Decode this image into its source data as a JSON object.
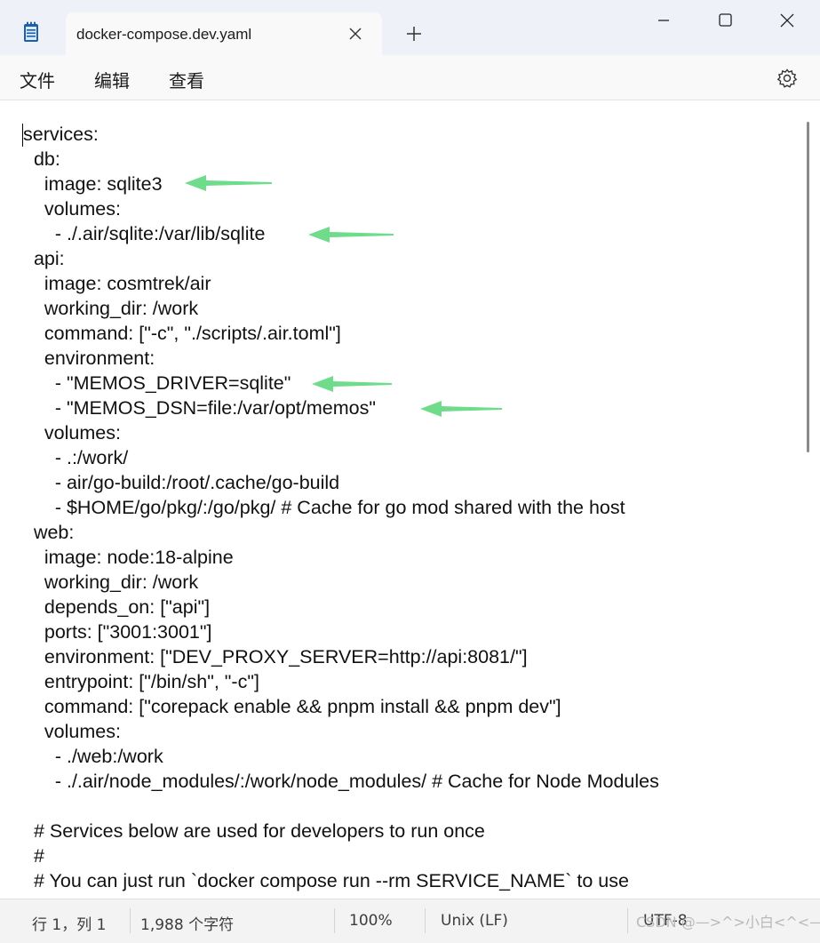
{
  "tab": {
    "title": "docker-compose.dev.yaml"
  },
  "menu": {
    "items": [
      "文件",
      "编辑",
      "查看"
    ]
  },
  "editor": {
    "lines": [
      "services:",
      "  db:",
      "    image: sqlite3",
      "    volumes:",
      "      - ./.air/sqlite:/var/lib/sqlite",
      "  api:",
      "    image: cosmtrek/air",
      "    working_dir: /work",
      "    command: [\"-c\", \"./scripts/.air.toml\"]",
      "    environment:",
      "      - \"MEMOS_DRIVER=sqlite\"",
      "      - \"MEMOS_DSN=file:/var/opt/memos\"",
      "    volumes:",
      "      - .:/work/",
      "      - air/go-build:/root/.cache/go-build",
      "      - $HOME/go/pkg/:/go/pkg/ # Cache for go mod shared with the host",
      "  web:",
      "    image: node:18-alpine",
      "    working_dir: /work",
      "    depends_on: [\"api\"]",
      "    ports: [\"3001:3001\"]",
      "    environment: [\"DEV_PROXY_SERVER=http://api:8081/\"]",
      "    entrypoint: [\"/bin/sh\", \"-c\"]",
      "    command: [\"corepack enable && pnpm install && pnpm dev\"]",
      "    volumes:",
      "      - ./web:/work",
      "      - ./.air/node_modules/:/work/node_modules/ # Cache for Node Modules",
      "",
      "  # Services below are used for developers to run once",
      "  #",
      "  # You can just run `docker compose run --rm SERVICE_NAME` to use",
      "  #"
    ],
    "highlight_color": "#6fdc8c"
  },
  "status": {
    "position": "行 1，列 1",
    "char_count": "1,988 个字符",
    "zoom": "100%",
    "line_ending": "Unix (LF)",
    "encoding": "UTF-8"
  },
  "watermark": "CSDN @—>^>小白<^<—"
}
